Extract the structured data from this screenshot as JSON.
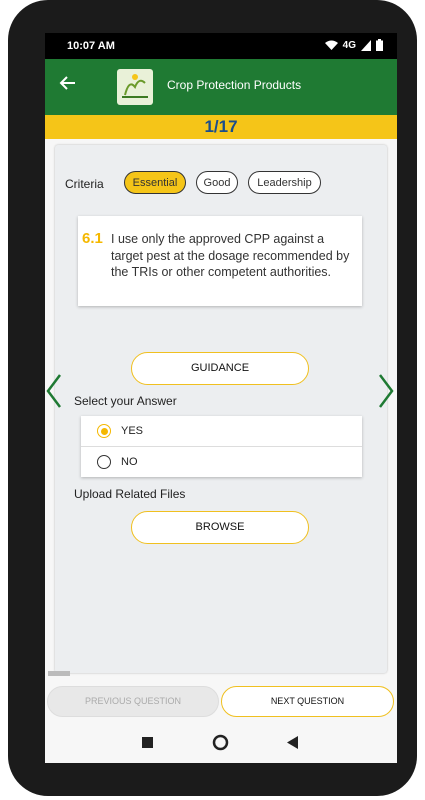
{
  "status": {
    "time": "10:07 AM",
    "network": "4G"
  },
  "appbar": {
    "title": "Crop Protection Products",
    "back_icon": "arrow-left-icon"
  },
  "progress": {
    "text": "1/17"
  },
  "criteria": {
    "label": "Criteria",
    "options": [
      "Essential",
      "Good",
      "Leadership"
    ],
    "selected": "Essential"
  },
  "question": {
    "number": "6.1",
    "text": "I use only the approved CPP against a target pest at the dosage recommended by the TRIs or other competent authorities."
  },
  "guidance_button": "GUIDANCE",
  "answer_section": {
    "label": "Select your Answer",
    "options": [
      {
        "label": "YES",
        "selected": true
      },
      {
        "label": "NO",
        "selected": false
      }
    ]
  },
  "upload": {
    "label": "Upload Related Files",
    "button": "BROWSE"
  },
  "footer": {
    "previous": "PREVIOUS QUESTION",
    "next": "NEXT QUESTION"
  },
  "colors": {
    "primary_green": "#1f7a33",
    "accent_yellow": "#f5c518",
    "progress_text": "#1a4d8c"
  }
}
